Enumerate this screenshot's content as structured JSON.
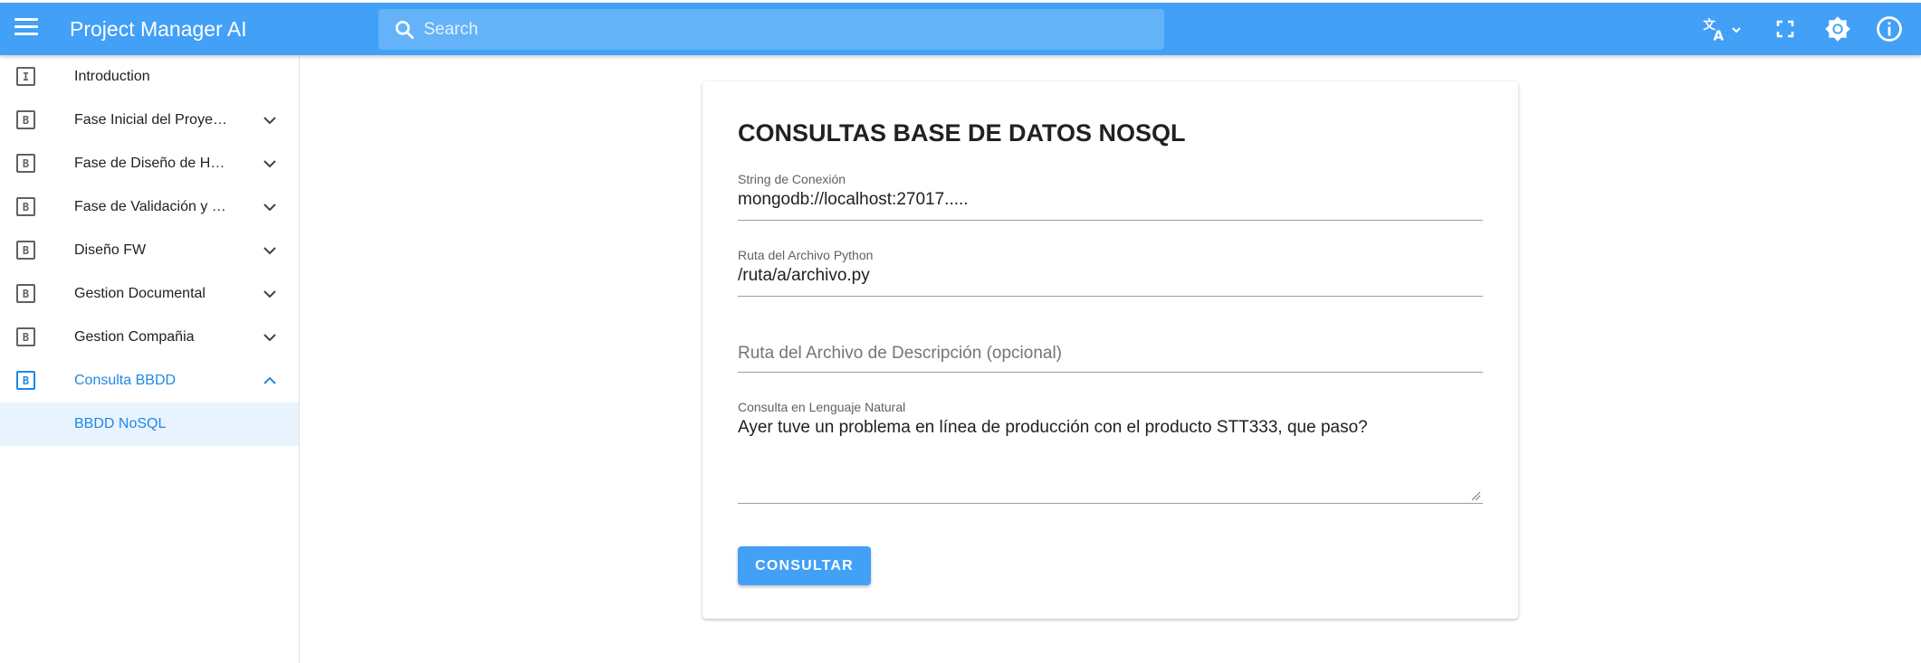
{
  "header": {
    "title": "Project Manager AI",
    "search_placeholder": "Search",
    "icons": [
      "menu-icon",
      "search-icon",
      "translate-icon",
      "chevron-down-icon",
      "fullscreen-icon",
      "brightness-icon",
      "info-icon"
    ]
  },
  "sidebar": {
    "items": [
      {
        "icon_letter": "I",
        "label": "Introduction",
        "expandable": false
      },
      {
        "icon_letter": "B",
        "label": "Fase Inicial del Proyecto",
        "expandable": true
      },
      {
        "icon_letter": "B",
        "label": "Fase de Diseño de Hardware",
        "expandable": true
      },
      {
        "icon_letter": "B",
        "label": "Fase de Validación y Verificación",
        "expandable": true
      },
      {
        "icon_letter": "B",
        "label": "Diseño FW",
        "expandable": true
      },
      {
        "icon_letter": "B",
        "label": "Gestion Documental",
        "expandable": true
      },
      {
        "icon_letter": "B",
        "label": "Gestion Compañia",
        "expandable": true
      },
      {
        "icon_letter": "B",
        "label": "Consulta BBDD",
        "expandable": true,
        "active": true
      }
    ],
    "subitems": [
      {
        "label": "BBDD NoSQL",
        "selected": true
      }
    ]
  },
  "main": {
    "title": "CONSULTAS BASE DE DATOS NOSQL",
    "fields": {
      "connection": {
        "label": "String de Conexión",
        "value": "mongodb://localhost:27017....."
      },
      "python_path": {
        "label": "Ruta del Archivo Python",
        "value": "/ruta/a/archivo.py"
      },
      "description_path": {
        "placeholder": "Ruta del Archivo de Descripción (opcional)"
      },
      "query": {
        "label": "Consulta en Lenguaje Natural",
        "value": "Ayer tuve un problema en línea de producción con el producto STT333, que paso?"
      }
    },
    "submit_label": "CONSULTAR"
  },
  "colors": {
    "accent": "#42a0f7",
    "active_text": "#1e88e5",
    "selected_bg": "#e8f3fe"
  }
}
